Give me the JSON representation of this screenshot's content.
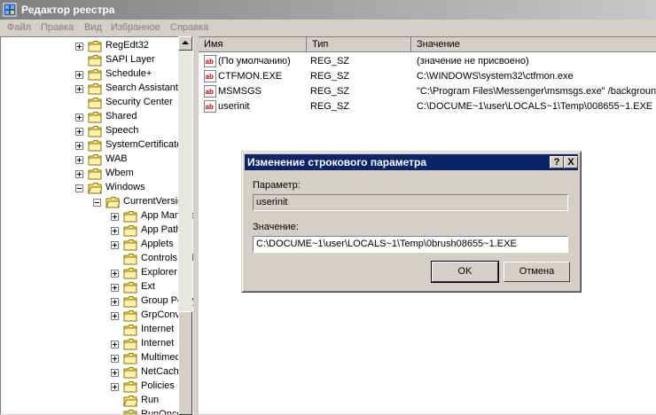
{
  "window": {
    "title": "Редактор реестра"
  },
  "menu": [
    "Файл",
    "Правка",
    "Вид",
    "Избранное",
    "Справка"
  ],
  "tree": [
    {
      "label": "RegEdt32",
      "expander": "plus",
      "level": 0
    },
    {
      "label": "SAPI Layer",
      "expander": "none",
      "level": 0
    },
    {
      "label": "Schedule+",
      "expander": "plus",
      "level": 0
    },
    {
      "label": "Search Assistant",
      "expander": "plus",
      "level": 0
    },
    {
      "label": "Security Center",
      "expander": "none",
      "level": 0
    },
    {
      "label": "Shared",
      "expander": "plus",
      "level": 0
    },
    {
      "label": "Speech",
      "expander": "plus",
      "level": 0
    },
    {
      "label": "SystemCertificates",
      "expander": "plus",
      "level": 0
    },
    {
      "label": "WAB",
      "expander": "plus",
      "level": 0
    },
    {
      "label": "Wbem",
      "expander": "plus",
      "level": 0
    },
    {
      "label": "Windows",
      "expander": "minus",
      "level": 0
    },
    {
      "label": "CurrentVersion",
      "expander": "minus",
      "level": 1
    },
    {
      "label": "App Management",
      "expander": "plus",
      "level": 2
    },
    {
      "label": "App Paths",
      "expander": "plus",
      "level": 2
    },
    {
      "label": "Applets",
      "expander": "plus",
      "level": 2
    },
    {
      "label": "Controls Folder",
      "expander": "none",
      "level": 2
    },
    {
      "label": "Explorer",
      "expander": "plus",
      "level": 2
    },
    {
      "label": "Ext",
      "expander": "plus",
      "level": 2
    },
    {
      "label": "Group Policy",
      "expander": "plus",
      "level": 2
    },
    {
      "label": "GrpConv",
      "expander": "plus",
      "level": 2
    },
    {
      "label": "Internet",
      "expander": "none",
      "level": 2
    },
    {
      "label": "Internet",
      "expander": "plus",
      "level": 2
    },
    {
      "label": "Multimedia",
      "expander": "plus",
      "level": 2
    },
    {
      "label": "NetCache",
      "expander": "plus",
      "level": 2
    },
    {
      "label": "Policies",
      "expander": "plus",
      "level": 2
    },
    {
      "label": "Run",
      "expander": "none",
      "level": 2,
      "open": true
    },
    {
      "label": "RunOnce",
      "expander": "none",
      "level": 2
    }
  ],
  "columns": {
    "name": "Имя",
    "type": "Тип",
    "value": "Значение"
  },
  "values": [
    {
      "name": "(По умолчанию)",
      "type": "REG_SZ",
      "data": "(значение не присвоено)"
    },
    {
      "name": "CTFMON.EXE",
      "type": "REG_SZ",
      "data": "C:\\WINDOWS\\system32\\ctfmon.exe"
    },
    {
      "name": "MSMSGS",
      "type": "REG_SZ",
      "data": "\"C:\\Program Files\\Messenger\\msmsgs.exe\" /background"
    },
    {
      "name": "userinit",
      "type": "REG_SZ",
      "data": "C:\\DOCUME~1\\user\\LOCALS~1\\Temp\\008655~1.EXE"
    }
  ],
  "dialog": {
    "title": "Изменение строкового параметра",
    "help_btn": "?",
    "close_btn": "X",
    "param_label": "Параметр:",
    "param_value": "userinit",
    "value_label": "Значение:",
    "value_value": "C:\\DOCUME~1\\user\\LOCALS~1\\Temp\\0brush08655~1.EXE",
    "ok": "OK",
    "cancel": "Отмена"
  },
  "colors": {
    "dialog_title": "#0a246a",
    "window_title_start": "#7f7f7f",
    "icon_red": "#c00000"
  }
}
